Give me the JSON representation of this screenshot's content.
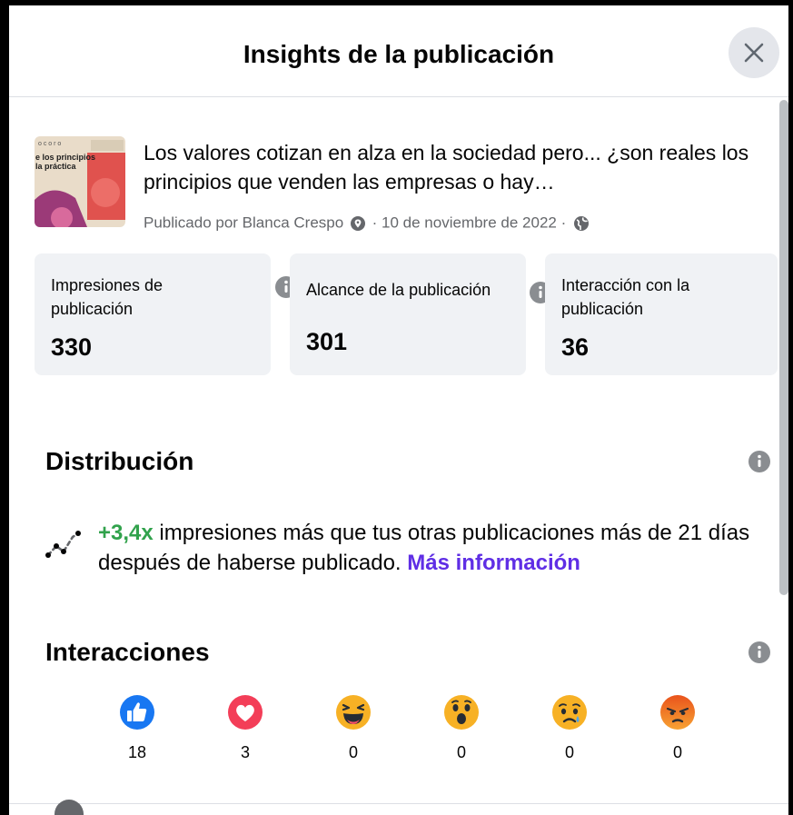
{
  "modal": {
    "title": "Insights de la publicación"
  },
  "post": {
    "text": "Los valores cotizan en alza en la sociedad pero... ¿son reales los principios que venden las empresas o hay…",
    "meta_prefix": "Publicado por Blanca Crespo",
    "meta_date": "· 10 de noviembre de 2022 ·",
    "thumbnail": {
      "header": "o c o r o",
      "line1": "e los principios",
      "line2": "la práctica"
    }
  },
  "metrics": [
    {
      "label": "Impresiones de publicación",
      "value": "330"
    },
    {
      "label": "Alcance de la publicación",
      "value": "301"
    },
    {
      "label": "Interacción con la publicación",
      "value": "36"
    }
  ],
  "distribution": {
    "title": "Distribución",
    "multiplier": "+3,4x",
    "text": " impresiones más que tus otras publicaciones más de 21 días después de haberse publicado. ",
    "link": "Más información"
  },
  "interactions": {
    "title": "Interacciones",
    "reactions": [
      {
        "name": "like",
        "count": "18"
      },
      {
        "name": "love",
        "count": "3"
      },
      {
        "name": "haha",
        "count": "0"
      },
      {
        "name": "wow",
        "count": "0"
      },
      {
        "name": "sad",
        "count": "0"
      },
      {
        "name": "angry",
        "count": "0"
      }
    ]
  },
  "colors": {
    "accent_link": "#5f2ee5",
    "positive": "#31a24c",
    "card_bg": "#f0f2f5",
    "secondary_text": "#65676b"
  }
}
